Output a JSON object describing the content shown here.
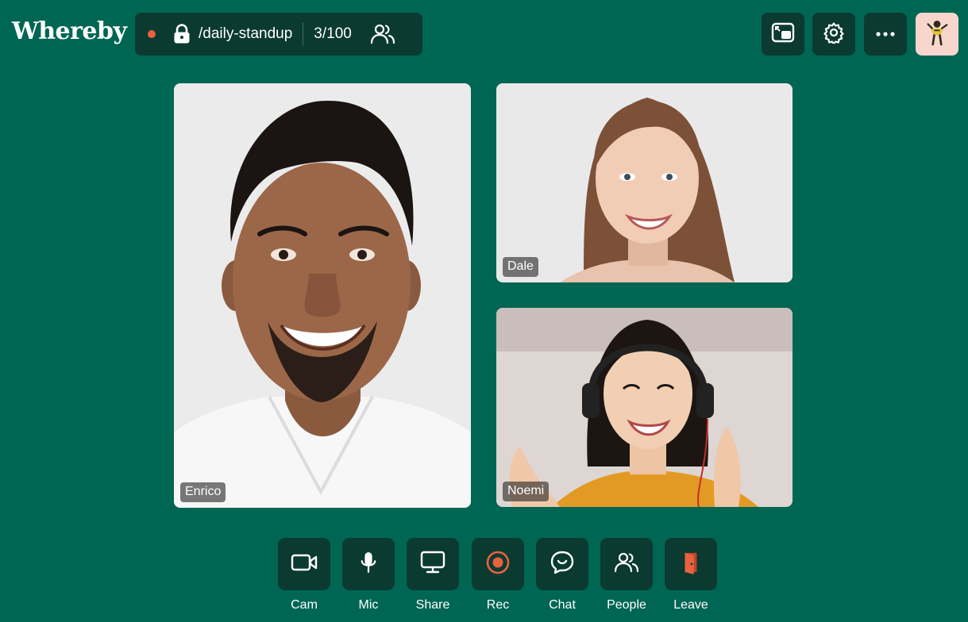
{
  "app": {
    "logo_text": "Whereby"
  },
  "room": {
    "name": "/daily-standup",
    "participant_count": "3/100",
    "recording_dot_color": "#e8623f",
    "icons": [
      "lock-icon",
      "people-icon"
    ]
  },
  "header_buttons": [
    {
      "name": "picture-in-picture-icon"
    },
    {
      "name": "gear-icon"
    },
    {
      "name": "more-horizontal-icon"
    }
  ],
  "user_avatar": {
    "background": "#f8d6ce",
    "icon": "superhero-character-icon"
  },
  "participants": [
    {
      "name": "Enrico"
    },
    {
      "name": "Dale"
    },
    {
      "name": "Noemi"
    }
  ],
  "controls": [
    {
      "label": "Cam",
      "icon": "camera-icon"
    },
    {
      "label": "Mic",
      "icon": "microphone-icon"
    },
    {
      "label": "Share",
      "icon": "screen-share-icon"
    },
    {
      "label": "Rec",
      "icon": "record-icon",
      "accent": "#e8623f"
    },
    {
      "label": "Chat",
      "icon": "chat-icon"
    },
    {
      "label": "People",
      "icon": "people-icon"
    },
    {
      "label": "Leave",
      "icon": "leave-door-icon",
      "accent": "#e8623f"
    }
  ],
  "colors": {
    "background": "#006654",
    "button": "#0b3a30",
    "accent": "#e8623f"
  }
}
